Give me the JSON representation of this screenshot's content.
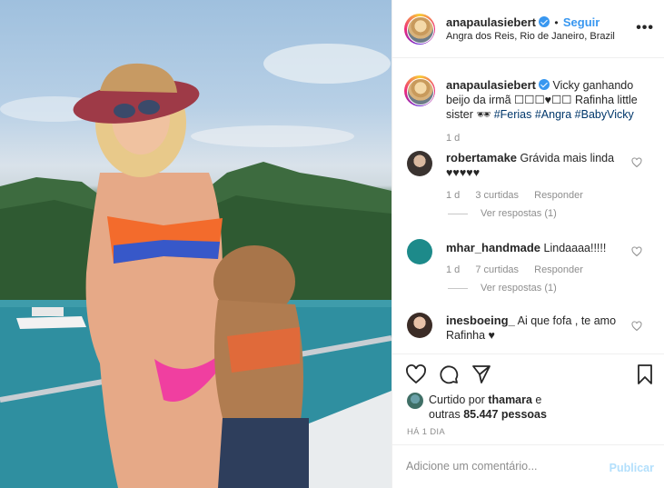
{
  "post": {
    "username": "anapaulasiebert",
    "follow_label": "Seguir",
    "dot": "•",
    "location": "Angra dos Reis, Rio de Janeiro, Brazil",
    "more_icon": "more-options-icon",
    "caption_text": " Vicky ganhando beijo da irmã ☐☐☐♥☐☐ Rafinha little sister 🕶 ",
    "hashtags": [
      "#Ferias",
      "#Angra",
      "#BabyVicky"
    ],
    "caption_time": "1 d"
  },
  "comments": [
    {
      "username": "robertamake",
      "text": "Grávida mais linda ♥♥♥♥♥",
      "time": "1 d",
      "likes": "3 curtidas",
      "reply_label": "Responder",
      "view_replies": "Ver respostas (1)"
    },
    {
      "username": "mhar_handmade",
      "text": "Lindaaaa!!!!!",
      "time": "1 d",
      "likes": "7 curtidas",
      "reply_label": "Responder",
      "view_replies": "Ver respostas (1)"
    },
    {
      "username": "inesboeing_",
      "text": " Ai que fofa , te amo Rafinha ♥"
    }
  ],
  "liked_by": {
    "prefix": "Curtido por ",
    "user": "thamara",
    "middle": " e",
    "line2_prefix": "outras ",
    "count": "85.447 pessoas"
  },
  "date": "HÁ 1 DIA",
  "comment_input": {
    "placeholder": "Adicione um comentário...",
    "publish_label": "Publicar"
  },
  "colors": {
    "accent": "#3897f0",
    "hashtag": "#00376b",
    "muted": "#8e8e8e",
    "publish": "#b2dffc"
  },
  "icons": [
    "heart-icon",
    "comment-icon",
    "share-icon",
    "bookmark-icon",
    "verified-badge-icon"
  ]
}
